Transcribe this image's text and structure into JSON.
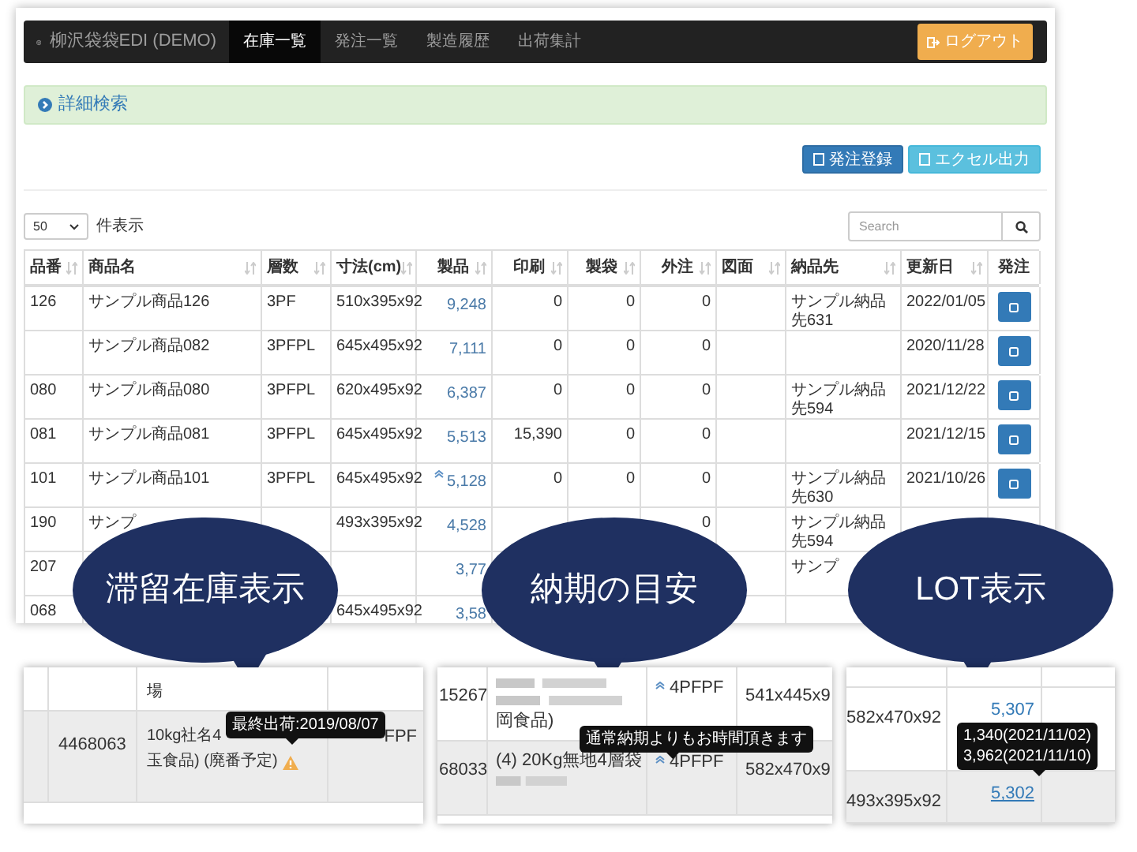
{
  "navbar": {
    "brand": "柳沢袋袋EDI (DEMO)",
    "tabs": [
      {
        "label": "在庫一覧",
        "selected": true
      },
      {
        "label": "発注一覧",
        "selected": false
      },
      {
        "label": "製造履歴",
        "selected": false
      },
      {
        "label": "出荷集計",
        "selected": false
      }
    ],
    "logout": "ログアウト"
  },
  "search_panel": {
    "title": "詳細検索"
  },
  "actions": [
    {
      "label": "発注登録",
      "kind": "primary"
    },
    {
      "label": "エクセル出力",
      "kind": "info"
    }
  ],
  "page_length": {
    "value": "50",
    "label": "件表示"
  },
  "search": {
    "placeholder": "Search"
  },
  "table": {
    "columns": [
      {
        "label": "品番",
        "kind": "text",
        "sortable": true
      },
      {
        "label": "商品名",
        "kind": "text",
        "sortable": true
      },
      {
        "label": "層数",
        "kind": "text",
        "sortable": true
      },
      {
        "label": "寸法(cm)",
        "kind": "text",
        "sortable": true
      },
      {
        "label": "製品",
        "kind": "number",
        "sortable": true
      },
      {
        "label": "印刷",
        "kind": "number",
        "sortable": true
      },
      {
        "label": "製袋",
        "kind": "number",
        "sortable": true
      },
      {
        "label": "外注",
        "kind": "number",
        "sortable": true
      },
      {
        "label": "図面",
        "kind": "text",
        "sortable": true
      },
      {
        "label": "納品先",
        "kind": "text",
        "sortable": true
      },
      {
        "label": "更新日",
        "kind": "text",
        "sortable": true
      },
      {
        "label": "発注",
        "kind": "button",
        "sortable": false
      }
    ],
    "rows": [
      {
        "cells": [
          "126",
          "サンプル商品126",
          "3PF",
          "510x395x92",
          "9,248",
          "0",
          "0",
          "0",
          "",
          "サンプル納品先631",
          "2022/01/05"
        ],
        "rising": false,
        "order_button": true
      },
      {
        "cells": [
          "",
          "サンプル商品082",
          "3PFPL",
          "645x495x92",
          "7,111",
          "0",
          "0",
          "0",
          "",
          "",
          "2020/11/28"
        ],
        "rising": false,
        "order_button": true
      },
      {
        "cells": [
          "080",
          "サンプル商品080",
          "3PFPL",
          "620x495x92",
          "6,387",
          "0",
          "0",
          "0",
          "",
          "サンプル納品先594",
          "2021/12/22"
        ],
        "rising": false,
        "order_button": true
      },
      {
        "cells": [
          "081",
          "サンプル商品081",
          "3PFPL",
          "645x495x92",
          "5,513",
          "15,390",
          "0",
          "0",
          "",
          "",
          "2021/12/15"
        ],
        "rising": false,
        "order_button": true
      },
      {
        "cells": [
          "101",
          "サンプル商品101",
          "3PFPL",
          "645x495x92",
          "5,128",
          "0",
          "0",
          "0",
          "",
          "サンプル納品先630",
          "2021/10/26"
        ],
        "rising": true,
        "order_button": true
      },
      {
        "cells": [
          "190",
          "サンプ",
          "",
          "493x395x92",
          "4,528",
          "",
          "",
          "0",
          "",
          "サンプル納品先594",
          ""
        ],
        "rising": false,
        "order_button": false
      },
      {
        "cells": [
          "207",
          "",
          "",
          "",
          "3,77",
          "",
          "",
          "",
          "",
          "サンプ",
          ""
        ],
        "rising": false,
        "order_button": false
      },
      {
        "cells": [
          "068",
          "",
          "",
          "645x495x92",
          "3,58",
          "",
          "",
          "",
          "",
          "",
          ""
        ],
        "rising": false,
        "order_button": false
      }
    ]
  },
  "callouts": [
    "滞留在庫表示",
    "納期の目安",
    "LOT表示"
  ],
  "stale_stock_example": {
    "rows": [
      {
        "code": "",
        "name": [
          "場"
        ],
        "layers": "",
        "warning": false,
        "shaded": false
      },
      {
        "code": "4468063",
        "name": [
          "10kg社名4",
          "玉食品) (廃番予定)"
        ],
        "layers": "FPF",
        "warning": true,
        "shaded": true
      }
    ],
    "tooltip": "最終出荷:2019/08/07"
  },
  "lead_time_example": {
    "rows": [
      {
        "code": "15267",
        "name": "岡食品)",
        "kind": "blurred_top",
        "layers": "4PFPF",
        "size": "541x445x9",
        "rush": true,
        "shaded": false
      },
      {
        "code": "68033",
        "name": "(4) 20Kg無地4層袋",
        "kind": "blurred_bottom",
        "layers": "4PFPF",
        "size": "582x470x9",
        "rush": true,
        "shaded": true
      }
    ],
    "tooltip": "通常納期よりもお時間頂きます"
  },
  "lot_example": {
    "rows": [
      {
        "size": "582x470x92",
        "stock": "5,307",
        "underlined": false,
        "shaded": false
      },
      {
        "size": "493x395x92",
        "stock": "5,302",
        "underlined": true,
        "shaded": true
      }
    ],
    "tooltip_lines": [
      "1,340(2021/11/02)",
      "3,962(2021/11/10)"
    ]
  }
}
